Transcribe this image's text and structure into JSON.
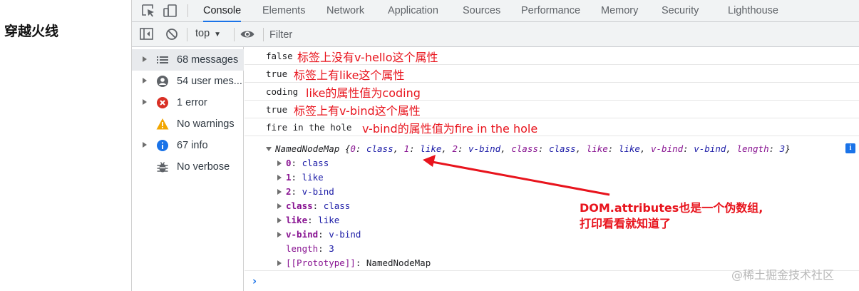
{
  "page_title": "穿越火线",
  "tabs": [
    {
      "label": "Console",
      "active": true
    },
    {
      "label": "Elements"
    },
    {
      "label": "Network"
    },
    {
      "label": "Application"
    },
    {
      "label": "Sources"
    },
    {
      "label": "Performance"
    },
    {
      "label": "Memory"
    },
    {
      "label": "Security"
    },
    {
      "label": "Lighthouse"
    }
  ],
  "toolbar": {
    "context": "top",
    "filter_placeholder": "Filter"
  },
  "sidebar": {
    "items": [
      {
        "label": "68 messages",
        "icon": "list-icon"
      },
      {
        "label": "54 user mes...",
        "icon": "user-icon"
      },
      {
        "label": "1 error",
        "icon": "error-icon"
      },
      {
        "label": "No warnings",
        "icon": "warning-icon"
      },
      {
        "label": "67 info",
        "icon": "info-icon"
      },
      {
        "label": "No verbose",
        "icon": "bug-icon"
      }
    ]
  },
  "logs": [
    {
      "value": "false",
      "note": "标签上没有v-hello这个属性"
    },
    {
      "value": "true",
      "note": "标签上有like这个属性"
    },
    {
      "value": "coding",
      "note": "like的属性值为coding"
    },
    {
      "value": "true",
      "note": "标签上有v-bind这个属性"
    },
    {
      "value": "fire in the hole",
      "note": "v-bind的属性值为fire in the hole"
    }
  ],
  "named_node_map": {
    "name": "NamedNodeMap",
    "preview": {
      "open": "{",
      "k0": "0",
      "v0": "class",
      "k1": "1",
      "v1": "like",
      "k2": "2",
      "v2": "v-bind",
      "k3": "class",
      "v3": "class",
      "k4": "like",
      "v4": "like",
      "k5": "v-bind",
      "v5": "v-bind",
      "k6": "length",
      "v6": "3",
      "close": "}"
    },
    "entries": [
      {
        "key": "0",
        "value": "class"
      },
      {
        "key": "1",
        "value": "like"
      },
      {
        "key": "2",
        "value": "v-bind"
      },
      {
        "key": "class",
        "value": "class"
      },
      {
        "key": "like",
        "value": "like"
      },
      {
        "key": "v-bind",
        "value": "v-bind"
      }
    ],
    "length_key": "length",
    "length_value": "3",
    "prototype_key": "[[Prototype]]",
    "prototype_value": "NamedNodeMap"
  },
  "annotation": {
    "line1": "DOM.attributes也是一个伪数组,",
    "line2": "打印看看就知道了"
  },
  "watermark": "@稀土掘金技术社区",
  "colors": {
    "annotation_red": "#e8141d",
    "active_tab_underline": "#1a73e8",
    "prop_purple": "#881391",
    "value_blue": "#1a1aa6"
  }
}
